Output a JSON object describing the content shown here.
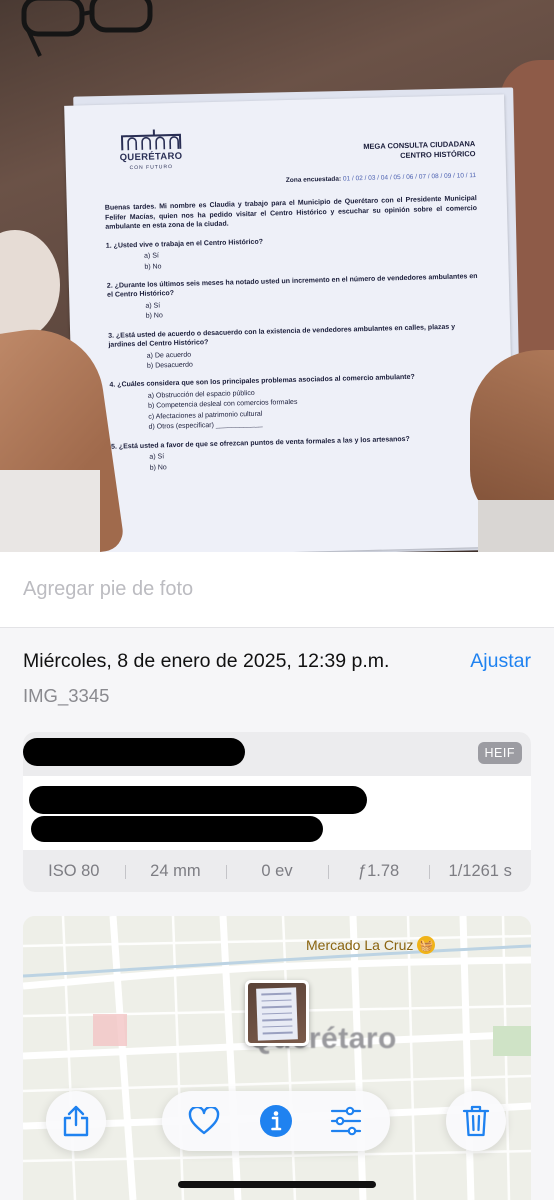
{
  "photo": {
    "document": {
      "logo_text": "QUERÉTARO",
      "logo_sub": "CON FUTURO",
      "title_line1": "MEGA CONSULTA CIUDADANA",
      "title_line2": "CENTRO HISTÓRICO",
      "zone_label": "Zona encuestada:",
      "zone_values": "01 / 02 / 03 / 04 / 05 / 06 / 07 / 08 / 09 / 10 / 11",
      "intro": "Buenas tardes. Mi nombre es Claudia y trabajo para el Municipio de Querétaro con el Presidente Municipal Felifer Macías, quien nos ha pedido visitar el Centro Histórico y escuchar su opinión sobre el comercio ambulante en esta zona de la ciudad.",
      "questions": [
        {
          "text": "1. ¿Usted vive o trabaja en el Centro Histórico?",
          "options": [
            "a) Sí",
            "b) No"
          ]
        },
        {
          "text": "2. ¿Durante los últimos seis meses ha notado usted un incremento en el número de vendedores ambulantes en el Centro Histórico?",
          "options": [
            "a) Sí",
            "b) No"
          ]
        },
        {
          "text": "3. ¿Está usted de acuerdo o desacuerdo con la existencia de vendedores ambulantes en calles, plazas y jardines del Centro Histórico?",
          "options": [
            "a) De acuerdo",
            "b) Desacuerdo"
          ]
        },
        {
          "text": "4. ¿Cuáles considera que son los principales problemas asociados al comercio ambulante?",
          "options": [
            "a) Obstrucción del espacio público",
            "b) Competencia desleal con comercios formales",
            "c) Afectaciones al patrimonio cultural",
            "d) Otros (especificar) ____________"
          ]
        },
        {
          "text": "5. ¿Está usted a favor de que se ofrezcan puntos de venta formales a las y los artesanos?",
          "options": [
            "a) Sí",
            "b) No"
          ]
        }
      ]
    }
  },
  "caption": {
    "placeholder": "Agregar pie de foto"
  },
  "info": {
    "date": "Miércoles, 8 de enero de 2025, 12:39 p.m.",
    "adjust_label": "Ajustar",
    "filename": "IMG_3345",
    "format_badge": "HEIF",
    "exif": [
      "ISO 80",
      "24 mm",
      "0 ev",
      "ƒ1.78",
      "1/1261 s"
    ]
  },
  "map": {
    "poi_label": "Mercado La Cruz",
    "city_label": "Querétaro"
  },
  "toolbar": {
    "icons": [
      "share-icon",
      "heart-icon",
      "info-icon",
      "sliders-icon",
      "trash-icon"
    ]
  },
  "colors": {
    "accent": "#1f82f0",
    "poi": "#f0b318"
  }
}
